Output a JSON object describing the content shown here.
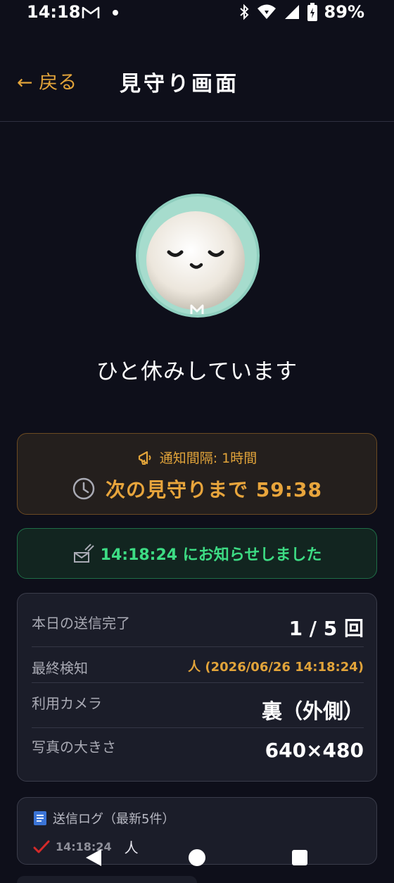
{
  "status_bar": {
    "time": "14:18",
    "battery": "89%"
  },
  "header": {
    "back_label": "← 戻る",
    "title": "見守り画面"
  },
  "mascot": {
    "state_text": "ひと休みしています"
  },
  "interval_card": {
    "interval_label": "通知間隔: 1時間",
    "next_label": "次の見守りまで 59:38"
  },
  "notify_card": {
    "text": "14:18:24 にお知らせしました"
  },
  "info": {
    "sent_today_label": "本日の送信完了",
    "sent_today_value": "1 / 5 回",
    "last_detect_label": "最終検知",
    "last_detect_value": "人 (2026/06/26 14:18:24)",
    "camera_label": "利用カメラ",
    "camera_value": "裏（外側）",
    "photo_size_label": "写真の大きさ",
    "photo_size_value": "640×480"
  },
  "log": {
    "title": "送信ログ（最新5件）",
    "entries": [
      {
        "time": "14:18:24",
        "detected": "人"
      }
    ]
  },
  "colors": {
    "accent": "#e2a43a",
    "success": "#3ddc84",
    "background": "#0e0f1a"
  }
}
